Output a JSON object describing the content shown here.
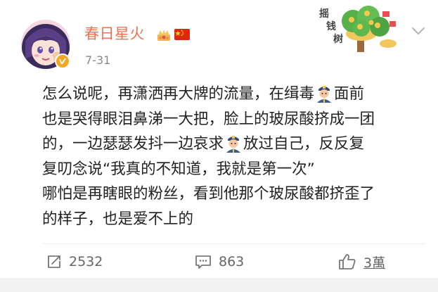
{
  "post": {
    "username": "春日星火",
    "date": "7-31",
    "lines": [
      {
        "before": "怎么说呢，再潇洒再大牌的流量，在缉毒",
        "emoji": "police-officer-emoji",
        "after": "面前"
      },
      {
        "before": "也是哭得眼泪鼻涕一大把，脸上的玻尿酸挤成一团",
        "emoji": "",
        "after": ""
      },
      {
        "before": "的，一边瑟瑟发抖一边哀求",
        "emoji": "police-officer-emoji",
        "after": "放过自己，反反复"
      },
      {
        "before": "复叨念说“我真的不知道，我就是第一次”",
        "emoji": "",
        "after": ""
      },
      {
        "before": "哪怕是再瞎眼的粉丝，看到他那个玻尿酸都挤歪了",
        "emoji": "",
        "after": ""
      },
      {
        "before": "的样子，也是爱不上的",
        "emoji": "",
        "after": ""
      }
    ]
  },
  "sticker": {
    "chars": [
      "摇",
      "钱",
      "树"
    ]
  },
  "actions": {
    "repost_count": "2532",
    "comment_count": "863",
    "like_count": "3萬"
  },
  "icons": {
    "repost": "repost-icon",
    "comment": "comment-icon",
    "like": "thumbs-up-icon",
    "more": "chevron-down-icon"
  },
  "colors": {
    "username": "#eb7350",
    "text": "#222222",
    "meta": "#8a8a8a",
    "verified": "#f5a623"
  }
}
